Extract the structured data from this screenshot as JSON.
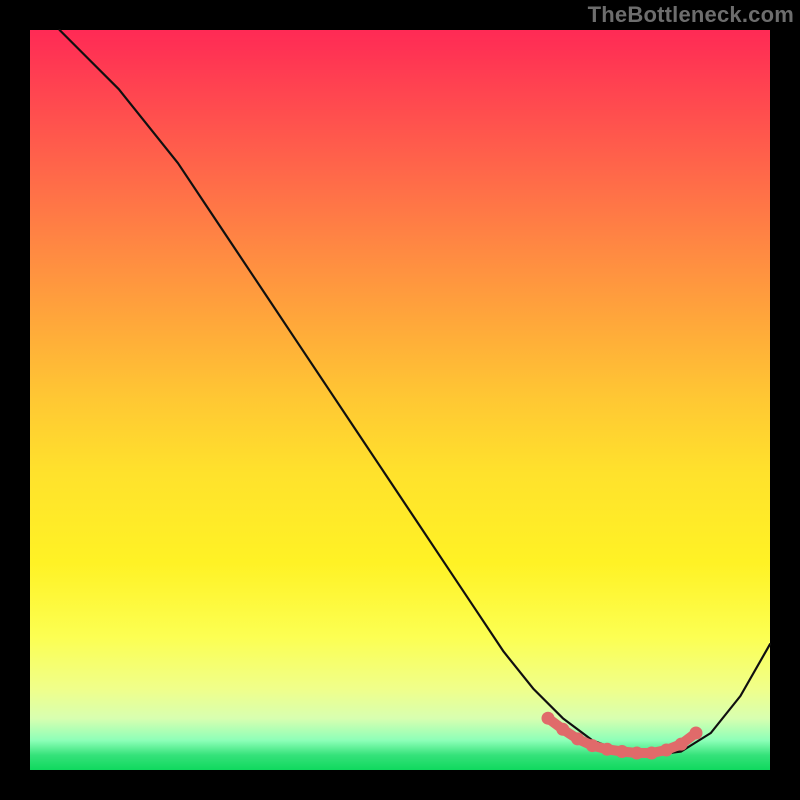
{
  "watermark": {
    "text": "TheBottleneck.com"
  },
  "colors": {
    "curve_stroke": "#101010",
    "highlight_stroke": "#e06a6a",
    "background": "#000000"
  },
  "chart_data": {
    "type": "line",
    "title": "",
    "xlabel": "",
    "ylabel": "",
    "xlim": [
      0,
      100
    ],
    "ylim": [
      0,
      100
    ],
    "grid": false,
    "legend": false,
    "series": [
      {
        "name": "curve",
        "x": [
          4,
          8,
          12,
          16,
          20,
          24,
          28,
          32,
          36,
          40,
          44,
          48,
          52,
          56,
          60,
          64,
          68,
          72,
          76,
          80,
          84,
          88,
          92,
          96,
          100
        ],
        "values": [
          100,
          96,
          92,
          87,
          82,
          76,
          70,
          64,
          58,
          52,
          46,
          40,
          34,
          28,
          22,
          16,
          11,
          7,
          4,
          2.5,
          2,
          2.5,
          5,
          10,
          17
        ]
      },
      {
        "name": "highlight",
        "x": [
          70,
          72,
          74,
          76,
          78,
          80,
          82,
          84,
          86,
          88,
          90
        ],
        "values": [
          7,
          5.5,
          4.2,
          3.3,
          2.8,
          2.5,
          2.3,
          2.3,
          2.7,
          3.5,
          5
        ]
      }
    ]
  }
}
